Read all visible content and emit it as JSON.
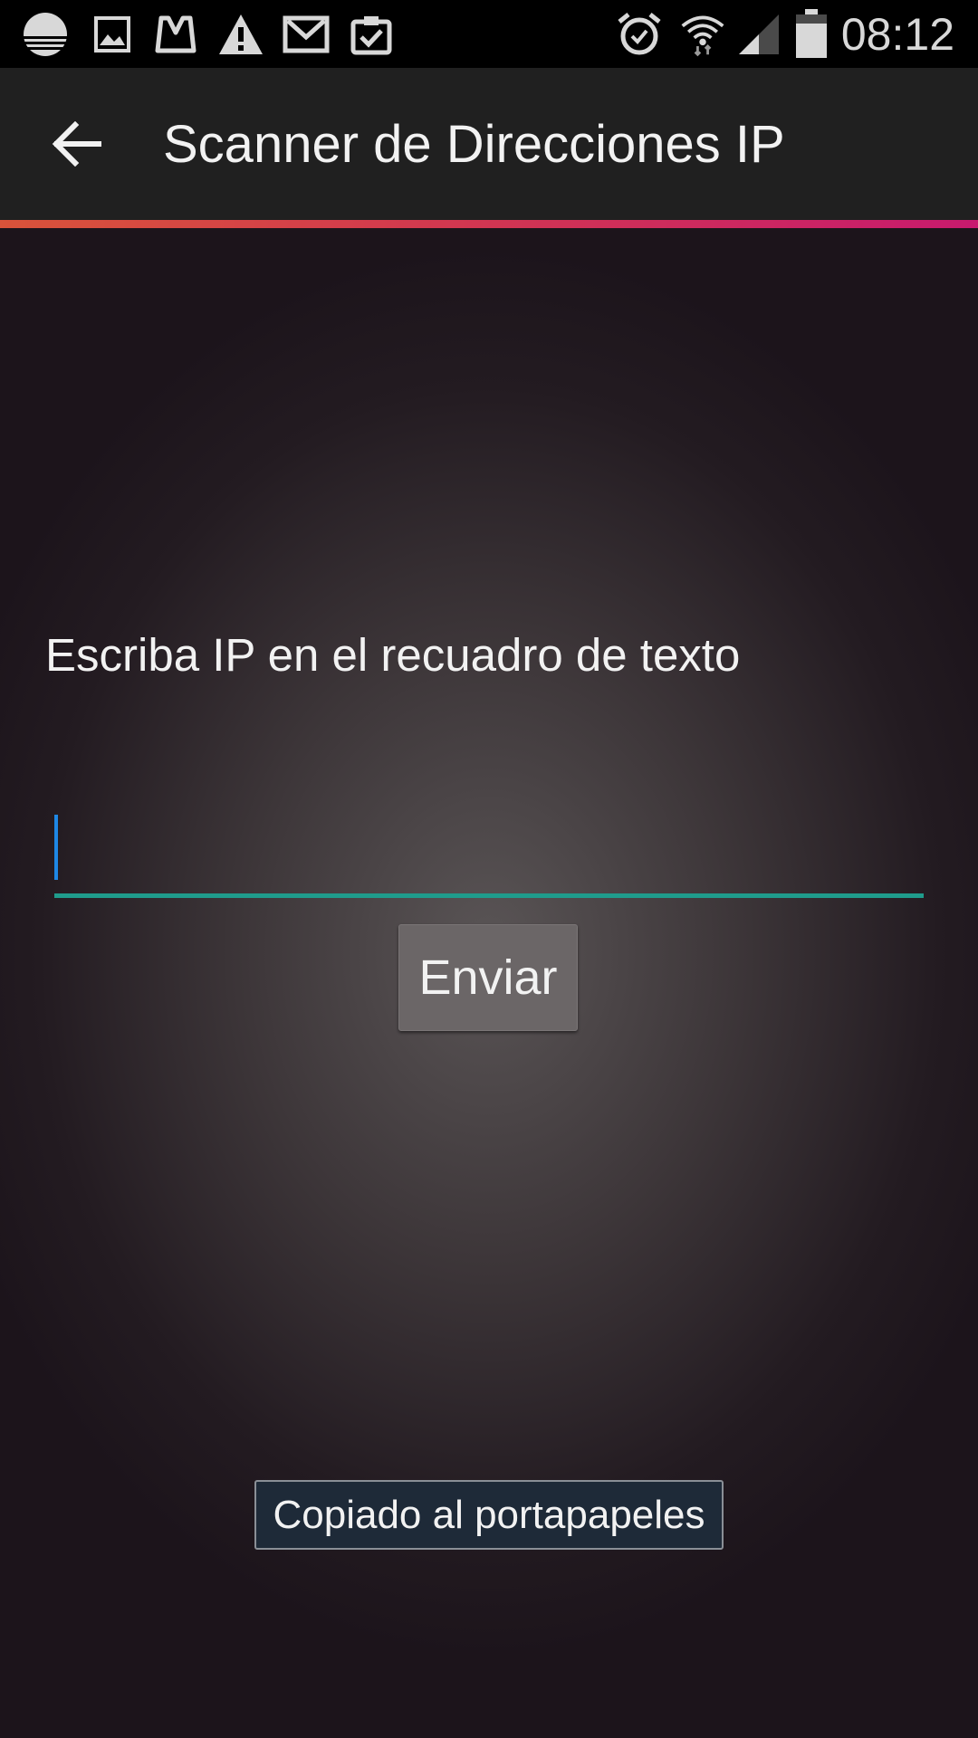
{
  "status_bar": {
    "time": "08:12",
    "left_icons": [
      "sync-icon",
      "image-icon",
      "inbox-icon",
      "warning-icon",
      "gmail-icon",
      "clipboard-check-icon"
    ],
    "right_icons": [
      "alarm-icon",
      "wifi-icon",
      "signal-icon",
      "battery-icon"
    ]
  },
  "app_bar": {
    "title": "Scanner de Direcciones IP",
    "back_icon": "arrow-back-icon",
    "accent_gradient": [
      "#d9533a",
      "#c81a6e"
    ]
  },
  "main": {
    "prompt": "Escriba IP en el recuadro de texto",
    "input_value": "",
    "input_accent": "#1f9c8c",
    "send_label": "Enviar"
  },
  "toast": {
    "message": "Copiado al portapapeles"
  }
}
